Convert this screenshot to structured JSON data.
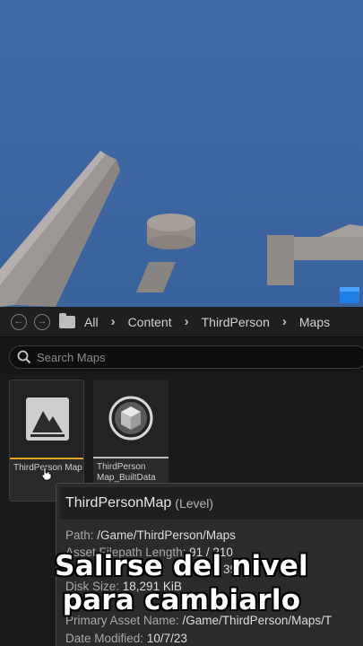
{
  "breadcrumb": {
    "items": [
      "All",
      "Content",
      "ThirdPerson",
      "Maps"
    ]
  },
  "search": {
    "placeholder": "Search Maps"
  },
  "assets": [
    {
      "name": "ThirdPerson Map",
      "icon": "level-map-icon",
      "accent": "#e0a020"
    },
    {
      "name": "ThirdPerson Map_BuiltData",
      "icon": "built-data-icon",
      "accent": "#bdbdbd"
    }
  ],
  "tooltip": {
    "title": "ThirdPersonMap",
    "type": "(Level)",
    "rows": [
      {
        "key": "Path:",
        "value": "/Game/ThirdPerson/Maps"
      },
      {
        "key": "Asset Filepath Length:",
        "value": "91 / 210"
      },
      {
        "key": "",
        "value": "39"
      },
      {
        "key": "Disk Size:",
        "value": "18,291 KiB"
      },
      {
        "key": "Primary Asset Name:",
        "value": "/Game/ThirdPerson/Maps/T"
      },
      {
        "key": "Date Modified:",
        "value": "10/7/23"
      }
    ]
  },
  "caption": {
    "line1": "Salirse del nivel",
    "line2": "para cambiarlo"
  },
  "colors": {
    "sky": "#3f6ba8",
    "panel": "#1a1a1a",
    "accent": "#e0a020"
  }
}
